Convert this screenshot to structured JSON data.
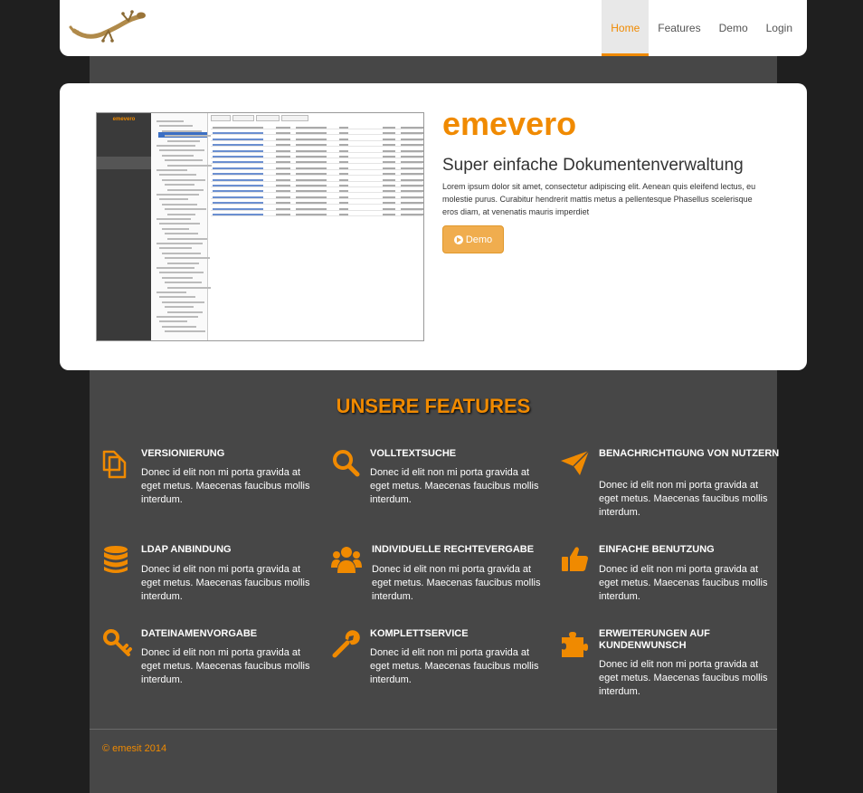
{
  "nav": {
    "items": [
      "Home",
      "Features",
      "Demo",
      "Login"
    ],
    "active": "Home"
  },
  "hero": {
    "title": "emevero",
    "subtitle": "Super einfache Dokumentenverwaltung",
    "text": "Lorem ipsum dolor sit amet, consectetur adipiscing elit. Aenean quis eleifend lectus, eu molestie purus. Curabitur hendrerit mattis metus a pellentesque Phasellus scelerisque eros diam, at venenatis mauris imperdiet",
    "button_label": "Demo",
    "screenshot_brand": "emevero"
  },
  "features": {
    "title": "UNSERE FEATURES",
    "items": [
      {
        "title": "VERSIONIERUNG",
        "text": "Donec id elit non mi porta gravida at eget metus. Maecenas faucibus mollis interdum.",
        "icon": "copy-icon"
      },
      {
        "title": "VOLLTEXTSUCHE",
        "text": "Donec id elit non mi porta gravida at eget metus. Maecenas faucibus mollis interdum.",
        "icon": "search-icon"
      },
      {
        "title": "BENACHRICHTIGUNG VON NUTZERN",
        "text": "Donec id elit non mi porta gravida at eget metus. Maecenas faucibus mollis interdum.",
        "icon": "paper-plane-icon"
      },
      {
        "title": "LDAP ANBINDUNG",
        "text": "Donec id elit non mi porta gravida at eget metus. Maecenas faucibus mollis interdum.",
        "icon": "database-icon"
      },
      {
        "title": "INDIVIDUELLE RECHTEVERGABE",
        "text": "Donec id elit non mi porta gravida at eget metus. Maecenas faucibus mollis interdum.",
        "icon": "users-icon"
      },
      {
        "title": "EINFACHE BENUTZUNG",
        "text": "Donec id elit non mi porta gravida at eget metus. Maecenas faucibus mollis interdum.",
        "icon": "thumbs-up-icon"
      },
      {
        "title": "DATEINAMENVORGABE",
        "text": "Donec id elit non mi porta gravida at eget metus. Maecenas faucibus mollis interdum.",
        "icon": "key-icon"
      },
      {
        "title": "KOMPLETTSERVICE",
        "text": "Donec id elit non mi porta gravida at eget metus. Maecenas faucibus mollis interdum.",
        "icon": "wrench-icon"
      },
      {
        "title": "ERWEITERUNGEN AUF KUNDENWUNSCH",
        "text": "Donec id elit non mi porta gravida at eget metus. Maecenas faucibus mollis interdum.",
        "icon": "puzzle-icon"
      }
    ]
  },
  "footer": {
    "copyright": "© emesit 2014"
  },
  "colors": {
    "accent": "#f08a00",
    "button": "#f0ad4e",
    "panel": "#474747",
    "background": "#1f1f1f"
  }
}
